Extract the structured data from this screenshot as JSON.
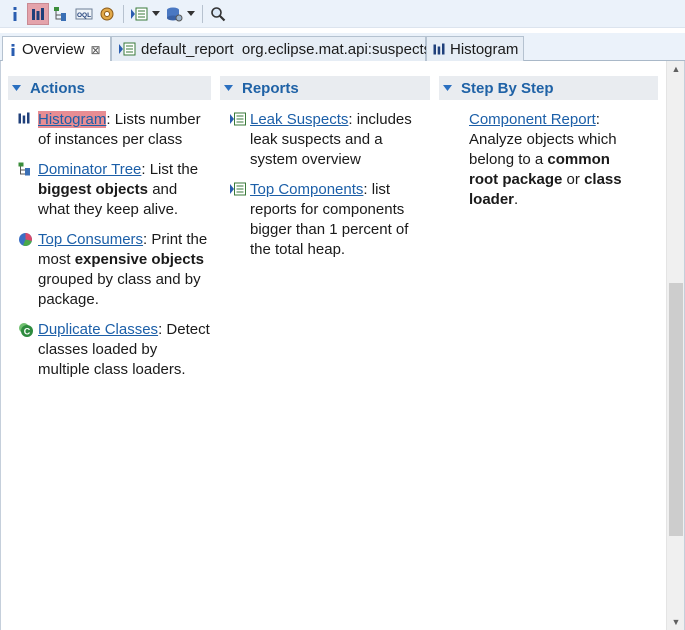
{
  "toolbar": {
    "buttons": [
      {
        "icon": "info-icon"
      },
      {
        "icon": "histogram-icon",
        "active": true
      },
      {
        "icon": "dominator-tree-icon"
      },
      {
        "icon": "oql-icon",
        "label": "OQL"
      },
      {
        "icon": "heap-dump-details-icon"
      },
      {
        "icon": "run-report-icon"
      },
      {
        "icon": "query-browser-icon"
      },
      {
        "icon": "search-icon"
      }
    ]
  },
  "tabs": [
    {
      "label": "Overview",
      "active": true,
      "icon": "info-icon",
      "closable": true
    },
    {
      "label": "default_report  org.eclipse.mat.api:suspects",
      "icon": "report-icon"
    },
    {
      "label": "Histogram",
      "icon": "histogram-icon"
    }
  ],
  "columns": {
    "actions": {
      "title": "Actions",
      "items": [
        {
          "link": "Histogram",
          "text": ": Lists number of instances per class",
          "icon": "histogram-icon"
        },
        {
          "link": "Dominator Tree",
          "text_before": ": List the ",
          "bold": "biggest objects",
          "text_after": " and what they keep alive.",
          "icon": "dominator-tree-icon"
        },
        {
          "link": "Top Consumers",
          "text_before": ": Print the most ",
          "bold": "expensive objects",
          "text_after": " grouped by class and by package.",
          "icon": "top-consumers-icon"
        },
        {
          "link": "Duplicate Classes",
          "text": ": Detect classes loaded by multiple class loaders.",
          "icon": "duplicate-classes-icon"
        }
      ]
    },
    "reports": {
      "title": "Reports",
      "items": [
        {
          "link": "Leak Suspects",
          "text": ": includes leak suspects and a system overview",
          "icon": "report-icon"
        },
        {
          "link": "Top Components",
          "text": ": list reports for components bigger than 1 percent of the total heap.",
          "icon": "report-icon"
        }
      ]
    },
    "stepbystep": {
      "title": "Step By Step",
      "items": [
        {
          "link": "Component Report",
          "text_before": ": Analyze objects which belong to a ",
          "bold1": "common root package",
          "text_mid": " or ",
          "bold2": "class loader",
          "text_after": "."
        }
      ]
    }
  },
  "colors": {
    "link": "#1c5fa8",
    "header_text": "#1f62a6",
    "highlight": "#e88d93",
    "toolbar_bg": "#ebf2fa"
  }
}
